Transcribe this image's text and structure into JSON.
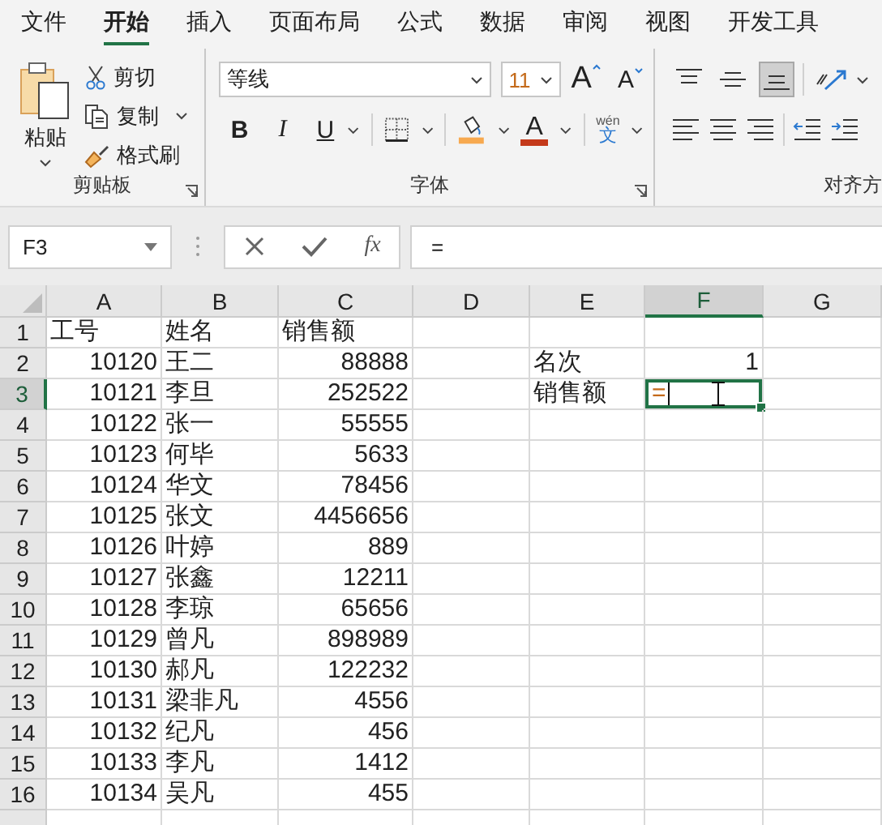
{
  "tabs": [
    {
      "label": "文件",
      "selected": false
    },
    {
      "label": "开始",
      "selected": true
    },
    {
      "label": "插入",
      "selected": false
    },
    {
      "label": "页面布局",
      "selected": false
    },
    {
      "label": "公式",
      "selected": false
    },
    {
      "label": "数据",
      "selected": false
    },
    {
      "label": "审阅",
      "selected": false
    },
    {
      "label": "视图",
      "selected": false
    },
    {
      "label": "开发工具",
      "selected": false
    }
  ],
  "clipboard": {
    "paste": "粘贴",
    "actions": [
      {
        "kind": "cut",
        "label": "剪切",
        "menu": false
      },
      {
        "kind": "copy",
        "label": "复制",
        "menu": true
      },
      {
        "kind": "painter",
        "label": "格式刷",
        "menu": false
      }
    ],
    "label": "剪贴板"
  },
  "font": {
    "name": "等线",
    "size": "11",
    "grow": "A",
    "shrink": "A",
    "styles": [
      {
        "kind": "bold",
        "label": "B"
      },
      {
        "kind": "italic",
        "label": "I"
      },
      {
        "kind": "underline",
        "label": "U"
      }
    ],
    "font_color": "A",
    "phonetic_top": "wén",
    "phonetic_bottom": "文",
    "label": "字体"
  },
  "alignment": {
    "vertical": [
      {
        "kind": "top",
        "selected": false
      },
      {
        "kind": "middle",
        "selected": false
      },
      {
        "kind": "bottom",
        "selected": true
      }
    ],
    "label": "对齐方"
  },
  "formula_bar": {
    "name_box": "F3",
    "fx": "fx",
    "formula": "="
  },
  "sheet": {
    "columns": [
      {
        "label": "A",
        "selected": false
      },
      {
        "label": "B",
        "selected": false
      },
      {
        "label": "C",
        "selected": false
      },
      {
        "label": "D",
        "selected": false
      },
      {
        "label": "E",
        "selected": false
      },
      {
        "label": "F",
        "selected": true
      },
      {
        "label": "G",
        "selected": false
      }
    ],
    "rows": [
      {
        "label": "1",
        "selected": false,
        "cells": [
          {
            "text": "工号",
            "kind": "text"
          },
          {
            "text": "姓名",
            "kind": "text"
          },
          {
            "text": "销售额",
            "kind": "text"
          },
          null,
          null,
          null,
          null
        ]
      },
      {
        "label": "2",
        "selected": false,
        "cells": [
          {
            "text": "10120",
            "kind": "number"
          },
          {
            "text": "王二",
            "kind": "text"
          },
          {
            "text": "88888",
            "kind": "number"
          },
          null,
          {
            "text": "名次",
            "kind": "text"
          },
          {
            "text": "1",
            "kind": "number"
          },
          null
        ]
      },
      {
        "label": "3",
        "selected": true,
        "cells": [
          {
            "text": "10121",
            "kind": "number"
          },
          {
            "text": "李旦",
            "kind": "text"
          },
          {
            "text": "252522",
            "kind": "number"
          },
          null,
          {
            "text": "销售额",
            "kind": "text"
          },
          {
            "text": "=",
            "kind": "text",
            "editing": true
          },
          null
        ]
      },
      {
        "label": "4",
        "selected": false,
        "cells": [
          {
            "text": "10122",
            "kind": "number"
          },
          {
            "text": "张一",
            "kind": "text"
          },
          {
            "text": "55555",
            "kind": "number"
          },
          null,
          null,
          null,
          null
        ]
      },
      {
        "label": "5",
        "selected": false,
        "cells": [
          {
            "text": "10123",
            "kind": "number"
          },
          {
            "text": "何毕",
            "kind": "text"
          },
          {
            "text": "5633",
            "kind": "number"
          },
          null,
          null,
          null,
          null
        ]
      },
      {
        "label": "6",
        "selected": false,
        "cells": [
          {
            "text": "10124",
            "kind": "number"
          },
          {
            "text": "华文",
            "kind": "text"
          },
          {
            "text": "78456",
            "kind": "number"
          },
          null,
          null,
          null,
          null
        ]
      },
      {
        "label": "7",
        "selected": false,
        "cells": [
          {
            "text": "10125",
            "kind": "number"
          },
          {
            "text": "张文",
            "kind": "text"
          },
          {
            "text": "4456656",
            "kind": "number"
          },
          null,
          null,
          null,
          null
        ]
      },
      {
        "label": "8",
        "selected": false,
        "cells": [
          {
            "text": "10126",
            "kind": "number"
          },
          {
            "text": "叶婷",
            "kind": "text"
          },
          {
            "text": "889",
            "kind": "number"
          },
          null,
          null,
          null,
          null
        ]
      },
      {
        "label": "9",
        "selected": false,
        "cells": [
          {
            "text": "10127",
            "kind": "number"
          },
          {
            "text": "张鑫",
            "kind": "text"
          },
          {
            "text": "12211",
            "kind": "number"
          },
          null,
          null,
          null,
          null
        ]
      },
      {
        "label": "10",
        "selected": false,
        "cells": [
          {
            "text": "10128",
            "kind": "number"
          },
          {
            "text": "李琼",
            "kind": "text"
          },
          {
            "text": "65656",
            "kind": "number"
          },
          null,
          null,
          null,
          null
        ]
      },
      {
        "label": "11",
        "selected": false,
        "cells": [
          {
            "text": "10129",
            "kind": "number"
          },
          {
            "text": "曾凡",
            "kind": "text"
          },
          {
            "text": "898989",
            "kind": "number"
          },
          null,
          null,
          null,
          null
        ]
      },
      {
        "label": "12",
        "selected": false,
        "cells": [
          {
            "text": "10130",
            "kind": "number"
          },
          {
            "text": "郝凡",
            "kind": "text"
          },
          {
            "text": "122232",
            "kind": "number"
          },
          null,
          null,
          null,
          null
        ]
      },
      {
        "label": "13",
        "selected": false,
        "cells": [
          {
            "text": "10131",
            "kind": "number"
          },
          {
            "text": "梁非凡",
            "kind": "text"
          },
          {
            "text": "4556",
            "kind": "number"
          },
          null,
          null,
          null,
          null
        ]
      },
      {
        "label": "14",
        "selected": false,
        "cells": [
          {
            "text": "10132",
            "kind": "number"
          },
          {
            "text": "纪凡",
            "kind": "text"
          },
          {
            "text": "456",
            "kind": "number"
          },
          null,
          null,
          null,
          null
        ]
      },
      {
        "label": "15",
        "selected": false,
        "cells": [
          {
            "text": "10133",
            "kind": "number"
          },
          {
            "text": "李凡",
            "kind": "text"
          },
          {
            "text": "1412",
            "kind": "number"
          },
          null,
          null,
          null,
          null
        ]
      },
      {
        "label": "16",
        "selected": false,
        "cells": [
          {
            "text": "10134",
            "kind": "number"
          },
          {
            "text": "吴凡",
            "kind": "text"
          },
          {
            "text": "455",
            "kind": "number"
          },
          null,
          null,
          null,
          null
        ]
      }
    ]
  }
}
